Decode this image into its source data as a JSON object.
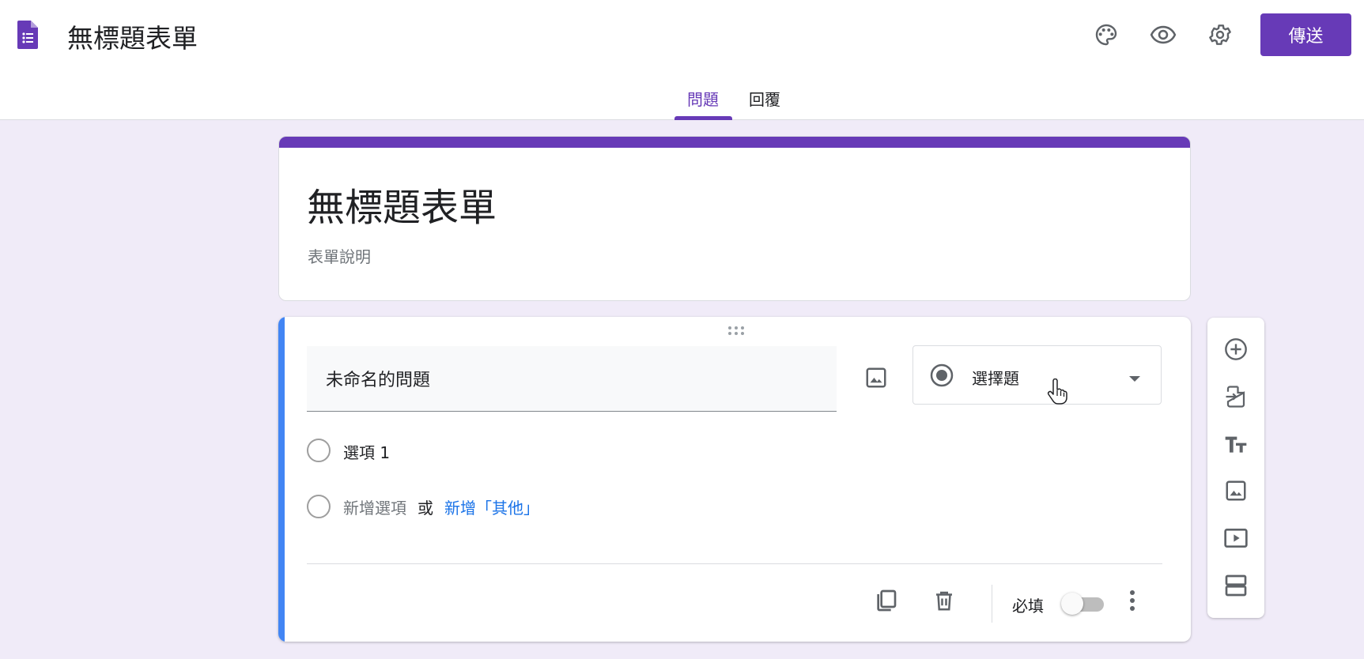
{
  "colors": {
    "brand": "#673ab7",
    "accent_blue": "#4285f4",
    "link": "#1a73e8",
    "background": "#f0ebf8"
  },
  "header": {
    "title": "無標題表單",
    "icons": [
      "forms-app-icon",
      "palette-icon",
      "preview-eye-icon",
      "settings-gear-icon"
    ],
    "send_label": "傳送",
    "tabs": [
      {
        "label": "問題",
        "active": true
      },
      {
        "label": "回覆",
        "active": false
      }
    ]
  },
  "form": {
    "title": "無標題表單",
    "description_placeholder": "表單說明"
  },
  "question": {
    "title_value": "未命名的問題",
    "type_label": "選擇題",
    "options": [
      {
        "label": "選項 1"
      }
    ],
    "add_option_label": "新增選項",
    "or_label": "或",
    "add_other_label": "新增「其他」",
    "required_label": "必填",
    "required": false
  },
  "side_toolbar": {
    "icons": [
      "add-question-icon",
      "import-questions-icon",
      "add-title-icon",
      "add-image-icon",
      "add-video-icon",
      "add-section-icon"
    ]
  }
}
